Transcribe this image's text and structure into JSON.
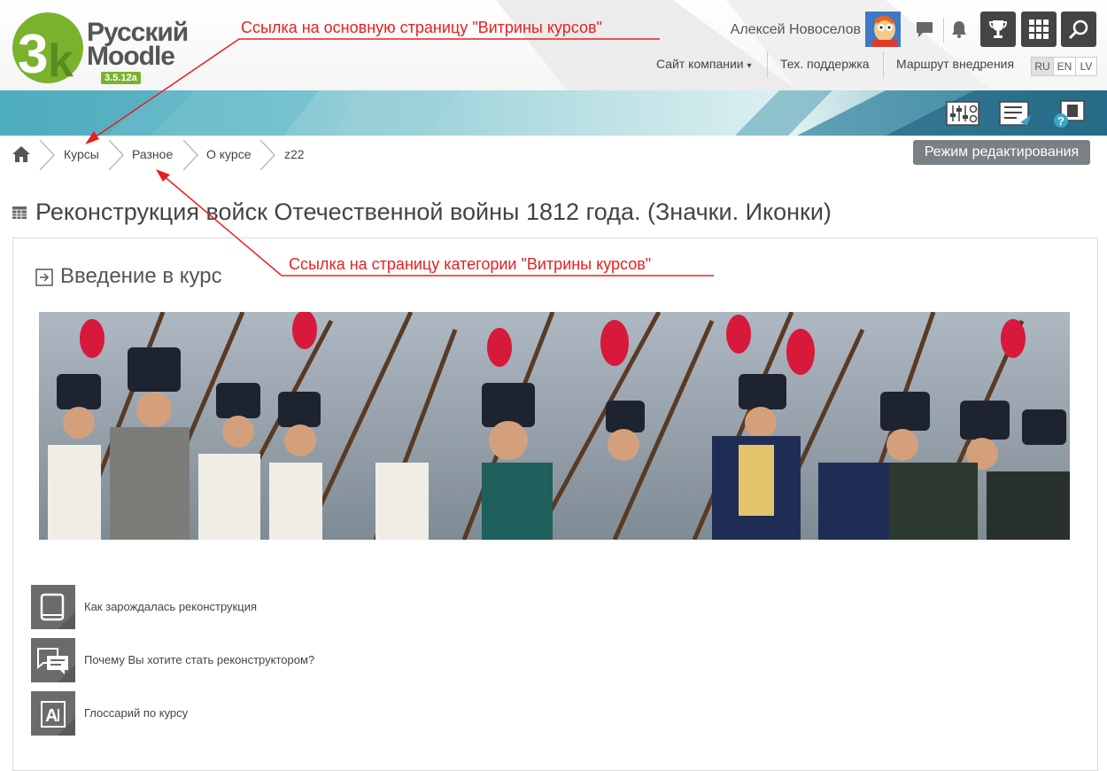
{
  "logo": {
    "line1": "Русский",
    "line2": "Moodle",
    "version": "3.5.12a"
  },
  "user": {
    "name": "Алексей Новоселов"
  },
  "topnav": {
    "company_site": "Сайт компании",
    "caret": "▾",
    "support": "Тех. поддержка",
    "route": "Маршрут внедрения",
    "langs": [
      "RU",
      "EN",
      "LV"
    ],
    "active_lang": "RU"
  },
  "icons": {
    "messages": "chat-bubble-icon",
    "notifications": "bell-icon",
    "achievements": "trophy-icon",
    "apps": "grid-icon",
    "search": "search-icon",
    "settings": "sliders-icon",
    "reports": "report-icon",
    "help": "help-icon",
    "home": "home-icon"
  },
  "breadcrumb": [
    "Курсы",
    "Разное",
    "О курсе",
    "z22"
  ],
  "edit_button": "Режим редактирования",
  "course": {
    "title": "Реконструкция войск Отечественной войны 1812 года. (Значки. Иконки)"
  },
  "section": {
    "title": "Введение в курс"
  },
  "activities": [
    {
      "label": "Как зарождалась реконструкция",
      "icon": "book-icon"
    },
    {
      "label": "Почему Вы хотите стать реконструктором?",
      "icon": "forum-icon"
    },
    {
      "label": "Глоссарий по курсу",
      "icon": "glossary-icon"
    }
  ],
  "annotations": {
    "top": "Ссылка на основную страницу \"Витрины курсов\"",
    "middle": "Ссылка на страницу категории \"Витрины курсов\""
  },
  "colors": {
    "accent_green": "#7ab22e",
    "annotation_red": "#e8201f",
    "dark_button": "#444444"
  }
}
